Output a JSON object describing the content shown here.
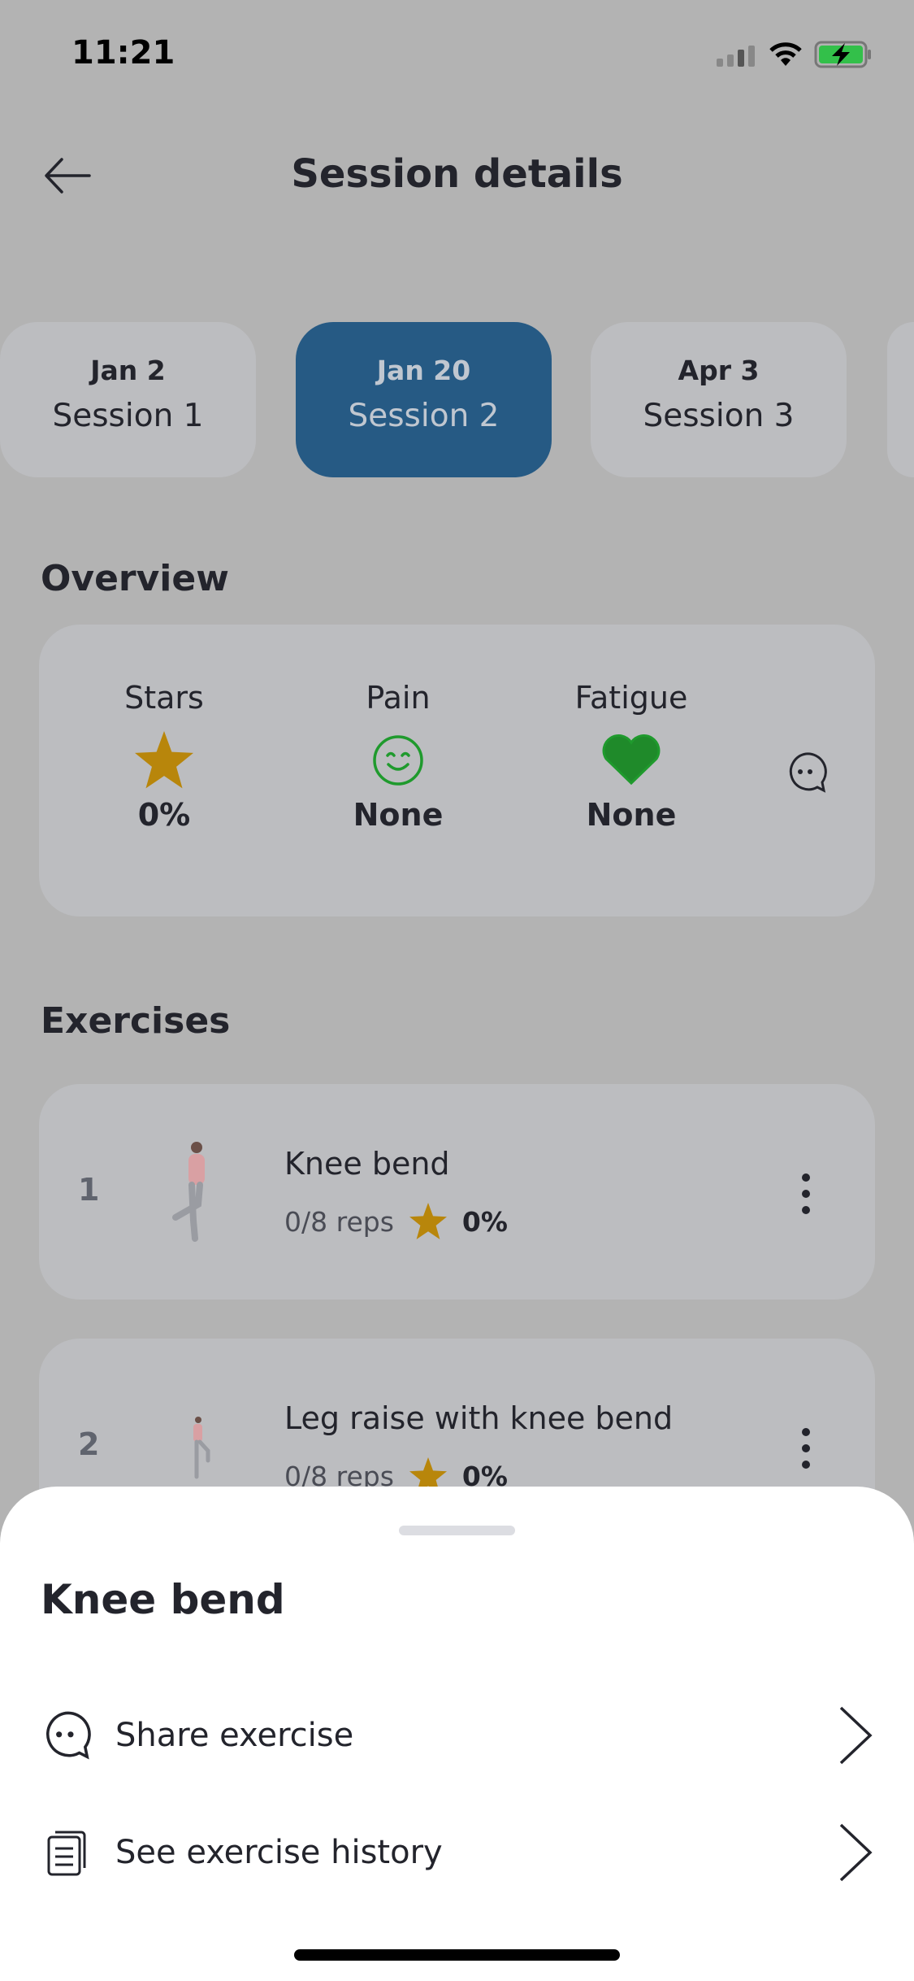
{
  "status": {
    "time": "11:21"
  },
  "header": {
    "title": "Session details"
  },
  "sessions": [
    {
      "date": "Jan 2",
      "label": "Session 1"
    },
    {
      "date": "Jan 20",
      "label": "Session 2"
    },
    {
      "date": "Apr 3",
      "label": "Session 3"
    }
  ],
  "overview": {
    "title": "Overview",
    "stars_label": "Stars",
    "stars_value": "0%",
    "pain_label": "Pain",
    "pain_value": "None",
    "fatigue_label": "Fatigue",
    "fatigue_value": "None"
  },
  "exercises": {
    "title": "Exercises",
    "items": [
      {
        "num": "1",
        "name": "Knee bend",
        "reps": "0/8 reps",
        "stars": "0%"
      },
      {
        "num": "2",
        "name": "Leg raise with knee bend",
        "reps": "0/8 reps",
        "stars": "0%"
      }
    ]
  },
  "sheet": {
    "title": "Knee bend",
    "share": "Share exercise",
    "history": "See exercise history"
  },
  "colors": {
    "accent": "#265a84",
    "star": "#b8860b",
    "green": "#1f9a2d"
  }
}
